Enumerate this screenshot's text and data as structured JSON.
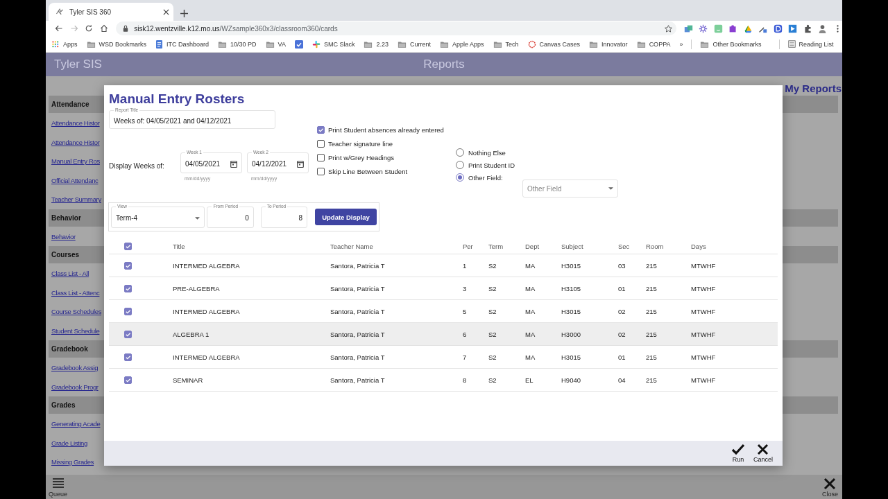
{
  "browser": {
    "tab_title": "Tyler SIS 360",
    "url_host": "sisk12.wentzville.k12.mo.us",
    "url_path": "/WZsample360x3/classroom360/cards",
    "bookmarks": [
      {
        "kind": "apps",
        "label": "Apps"
      },
      {
        "kind": "folder",
        "label": "WSD Bookmarks"
      },
      {
        "kind": "page",
        "label": "ITC Dashboard"
      },
      {
        "kind": "folder",
        "label": "10/30 PD"
      },
      {
        "kind": "folder",
        "label": "VA"
      },
      {
        "kind": "check"
      },
      {
        "kind": "slack",
        "label": "SMC Slack"
      },
      {
        "kind": "folder",
        "label": "2.23"
      },
      {
        "kind": "folder",
        "label": "Current"
      },
      {
        "kind": "folder",
        "label": "Apple Apps"
      },
      {
        "kind": "folder",
        "label": "Tech"
      },
      {
        "kind": "ring",
        "label": "Canvas Cases"
      },
      {
        "kind": "folder",
        "label": "Innovator"
      },
      {
        "kind": "folder",
        "label": "COPPA"
      }
    ],
    "overflow": "»",
    "other_bookmarks": "Other Bookmarks",
    "reading_list": "Reading List"
  },
  "app": {
    "brand": "Tyler SIS",
    "page_title": "Reports",
    "right_heading": "My Reports"
  },
  "sidebar": [
    {
      "heading": "Attendance",
      "links": [
        "Attendance Histor",
        "Attendance Histor",
        "Manual Entry Ros",
        "Official Attendanc",
        "Teacher Summary"
      ]
    },
    {
      "heading": "Behavior",
      "links": [
        "Behavior"
      ]
    },
    {
      "heading": "Courses",
      "links": [
        "Class List - All",
        "Class List - Attenc",
        "Course Schedules",
        "Student Schedule"
      ]
    },
    {
      "heading": "Gradebook",
      "links": [
        "Gradebook Assig",
        "Gradebook Progr"
      ]
    },
    {
      "heading": "Grades",
      "links": [
        "Generating Acade",
        "Grade Listing",
        "Missing Grades"
      ]
    }
  ],
  "modal": {
    "title": "Manual Entry Rosters",
    "report_title": {
      "label": "Report Title",
      "value": "Weeks of: 04/05/2021 and 04/12/2021"
    },
    "display_weeks_label": "Display Weeks of:",
    "weeks": [
      {
        "label": "Week 1",
        "value": "04/05/2021",
        "hint": "mm/dd/yyyy"
      },
      {
        "label": "Week 2",
        "value": "04/12/2021",
        "hint": "mm/dd/yyyy"
      }
    ],
    "options": [
      {
        "label": "Print Student absences already entered",
        "checked": true
      },
      {
        "label": "Teacher signature line",
        "checked": false
      },
      {
        "label": "Print w/Grey Headings",
        "checked": false
      },
      {
        "label": "Skip Line Between Student",
        "checked": false
      }
    ],
    "extra_fields": [
      {
        "label": "Nothing Else",
        "selected": false
      },
      {
        "label": "Print Student ID",
        "selected": false
      },
      {
        "label": "Other Field:",
        "selected": true
      }
    ],
    "other_field": {
      "placeholder": "Other Field"
    },
    "view": {
      "label": "View",
      "value": "Term-4"
    },
    "from_period": {
      "label": "From Period",
      "value": "0"
    },
    "to_period": {
      "label": "To Period",
      "value": "8"
    },
    "update_button": "Update Display",
    "table": {
      "header_checked": true,
      "columns": [
        "Title",
        "Teacher Name",
        "Per",
        "Term",
        "Dept",
        "Subject",
        "Sec",
        "Room",
        "Days"
      ],
      "rows": [
        {
          "checked": true,
          "highlighted": false,
          "cells": [
            "INTERMED ALGEBRA",
            "Santora, Patricia T",
            "1",
            "S2",
            "MA",
            "H3015",
            "03",
            "215",
            "MTWHF"
          ]
        },
        {
          "checked": true,
          "highlighted": false,
          "cells": [
            "PRE-ALGEBRA",
            "Santora, Patricia T",
            "3",
            "S2",
            "MA",
            "H3105",
            "01",
            "215",
            "MTWHF"
          ]
        },
        {
          "checked": true,
          "highlighted": false,
          "cells": [
            "INTERMED ALGEBRA",
            "Santora, Patricia T",
            "5",
            "S2",
            "MA",
            "H3015",
            "02",
            "215",
            "MTWHF"
          ]
        },
        {
          "checked": true,
          "highlighted": true,
          "cells": [
            "ALGEBRA 1",
            "Santora, Patricia T",
            "6",
            "S2",
            "MA",
            "H3000",
            "02",
            "215",
            "MTWHF"
          ]
        },
        {
          "checked": true,
          "highlighted": false,
          "cells": [
            "INTERMED ALGEBRA",
            "Santora, Patricia T",
            "7",
            "S2",
            "MA",
            "H3015",
            "01",
            "215",
            "MTWHF"
          ]
        },
        {
          "checked": true,
          "highlighted": false,
          "cells": [
            "SEMINAR",
            "Santora, Patricia T",
            "8",
            "S2",
            "EL",
            "H9040",
            "04",
            "215",
            "MTWHF"
          ]
        }
      ]
    },
    "actions": [
      {
        "kind": "run",
        "label": "Run"
      },
      {
        "kind": "cancel",
        "label": "Cancel"
      }
    ]
  },
  "bottom_bar": {
    "queue": "Queue",
    "close": "Close"
  }
}
